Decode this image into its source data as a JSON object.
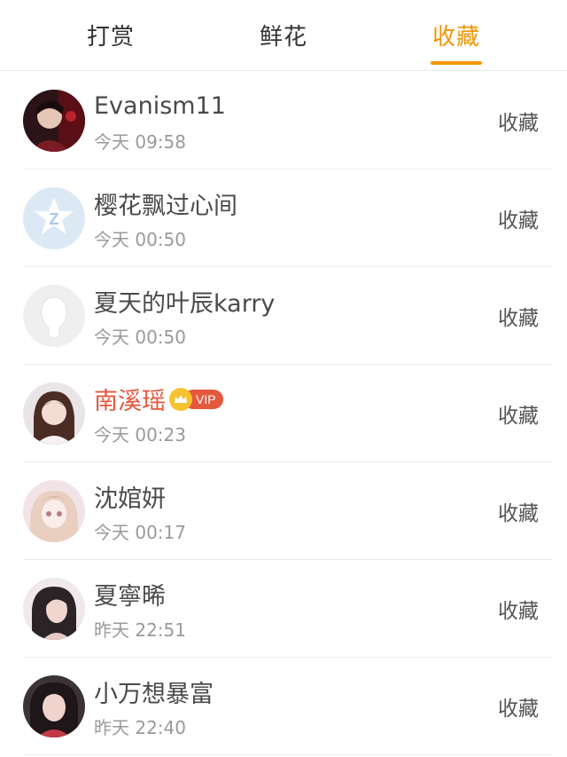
{
  "tabs": [
    {
      "label": "打赏",
      "active": false
    },
    {
      "label": "鲜花",
      "active": false
    },
    {
      "label": "收藏",
      "active": true
    }
  ],
  "colors": {
    "accent": "#f29600",
    "vip": "#e4583e",
    "text": "#4a4a4a",
    "subtext": "#9a9a9a"
  },
  "items": [
    {
      "name": "Evanism11",
      "time": "今天 09:58",
      "action": "收藏",
      "vip": false
    },
    {
      "name": "樱花飘过心间",
      "time": "今天 00:50",
      "action": "收藏",
      "vip": false
    },
    {
      "name": "夏天的叶辰karry",
      "time": "今天 00:50",
      "action": "收藏",
      "vip": false
    },
    {
      "name": "南溪瑶",
      "time": "今天 00:23",
      "action": "收藏",
      "vip": true,
      "vip_label": "VIP"
    },
    {
      "name": "沈婠妍",
      "time": "今天 00:17",
      "action": "收藏",
      "vip": false
    },
    {
      "name": "夏寧晞",
      "time": "昨天 22:51",
      "action": "收藏",
      "vip": false
    },
    {
      "name": "小万想暴富",
      "time": "昨天 22:40",
      "action": "收藏",
      "vip": false
    }
  ]
}
